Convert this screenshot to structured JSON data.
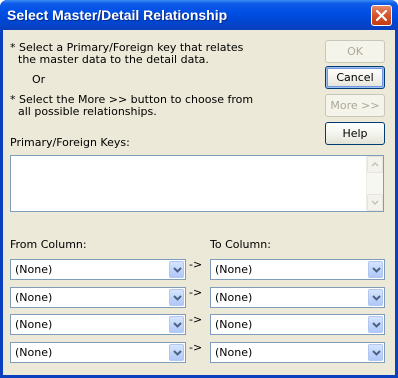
{
  "window": {
    "title": "Select Master/Detail Relationship"
  },
  "instructions": {
    "line1": "* Select a Primary/Foreign key that relates",
    "line2": "the master data to the detail data.",
    "or": "Or",
    "line3": "* Select the More >> button to choose from",
    "line4": "all possible relationships."
  },
  "buttons": {
    "ok": "OK",
    "cancel": "Cancel",
    "more": "More >>",
    "help": "Help"
  },
  "keys": {
    "label": "Primary/Foreign Keys:"
  },
  "columns": {
    "from_label": "From Column:",
    "to_label": "To Column:",
    "arrow": "->",
    "rows": [
      {
        "from": "(None)",
        "to": "(None)"
      },
      {
        "from": "(None)",
        "to": "(None)"
      },
      {
        "from": "(None)",
        "to": "(None)"
      },
      {
        "from": "(None)",
        "to": "(None)"
      }
    ]
  },
  "colors": {
    "titlebar": "#0050e6",
    "client": "#ece9d8",
    "close": "#d9552b"
  }
}
